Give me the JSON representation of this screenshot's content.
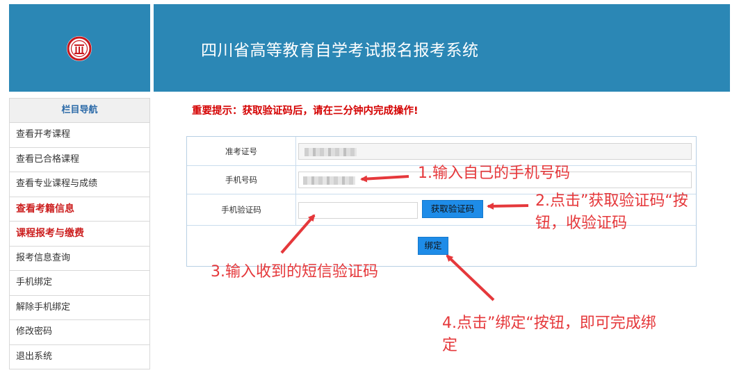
{
  "header": {
    "title": "四川省高等教育自学考试报名报考系统"
  },
  "sidebar": {
    "heading": "栏目导航",
    "items": [
      {
        "label": "查看开考课程"
      },
      {
        "label": "查看已合格课程"
      },
      {
        "label": "查看专业课程与成绩"
      },
      {
        "label": "查看考籍信息"
      },
      {
        "label": "课程报考与缴费"
      },
      {
        "label": "报考信息查询"
      },
      {
        "label": "手机绑定"
      },
      {
        "label": "解除手机绑定"
      },
      {
        "label": "修改密码"
      },
      {
        "label": "退出系统"
      }
    ]
  },
  "notice": "重要提示：获取验证码后，请在三分钟内完成操作!",
  "form": {
    "exam_id_label": "准考证号",
    "phone_label": "手机号码",
    "code_label": "手机验证码",
    "get_code_button": "获取验证码",
    "bind_button": "绑定"
  },
  "annotations": {
    "step1": "1.输入自己的手机号码",
    "step2_line1": "2.点击”获取验证码“按",
    "step2_line2": "钮，收验证码",
    "step3": "3.输入收到的短信验证码",
    "step4_line1": "4.点击”绑定“按钮，即可完成绑",
    "step4_line2": "定"
  },
  "colors": {
    "header_bg": "#2b87b5",
    "button_bg": "#1e8ce8",
    "notice_red": "#d40000",
    "annotation_red": "#e5383b"
  }
}
